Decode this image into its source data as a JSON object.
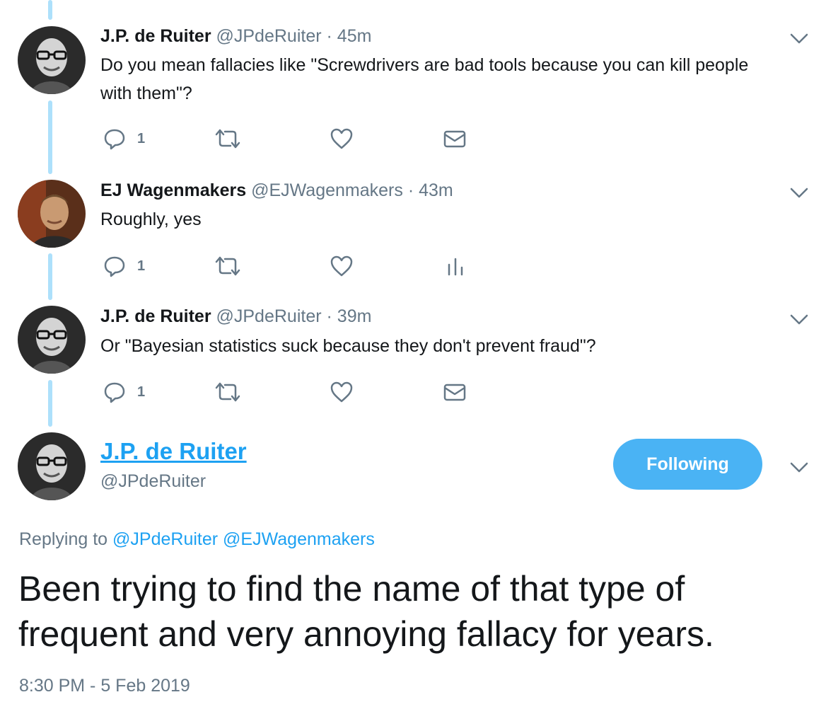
{
  "tweets": [
    {
      "name": "J.P. de Ruiter",
      "handle": "@JPdeRuiter",
      "separator": "·",
      "time": "45m",
      "text": "Do you mean fallacies like \"Screwdrivers are bad tools because you can kill people with them\"?",
      "reply_count": "1",
      "extra_action_icon": "envelope-icon"
    },
    {
      "name": "EJ Wagenmakers",
      "handle": "@EJWagenmakers",
      "separator": "·",
      "time": "43m",
      "text": "Roughly, yes",
      "reply_count": "1",
      "extra_action_icon": "analytics-icon"
    },
    {
      "name": "J.P. de Ruiter",
      "handle": "@JPdeRuiter",
      "separator": "·",
      "time": "39m",
      "text": "Or \"Bayesian statistics suck because they don't prevent fraud\"?",
      "reply_count": "1",
      "extra_action_icon": "envelope-icon"
    }
  ],
  "focal": {
    "name": "J.P. de Ruiter",
    "handle": "@JPdeRuiter",
    "follow_label": "Following",
    "replying_label": "Replying to",
    "mentions": [
      "@JPdeRuiter",
      "@EJWagenmakers"
    ],
    "text": "Been trying to find the name of that type of frequent and very annoying fallacy for years.",
    "timestamp": "8:30 PM - 5 Feb 2019"
  },
  "colors": {
    "accent": "#1da1f2",
    "button": "#4ab3f4",
    "thread_line": "#ade0fb",
    "secondary_text": "#657786"
  }
}
